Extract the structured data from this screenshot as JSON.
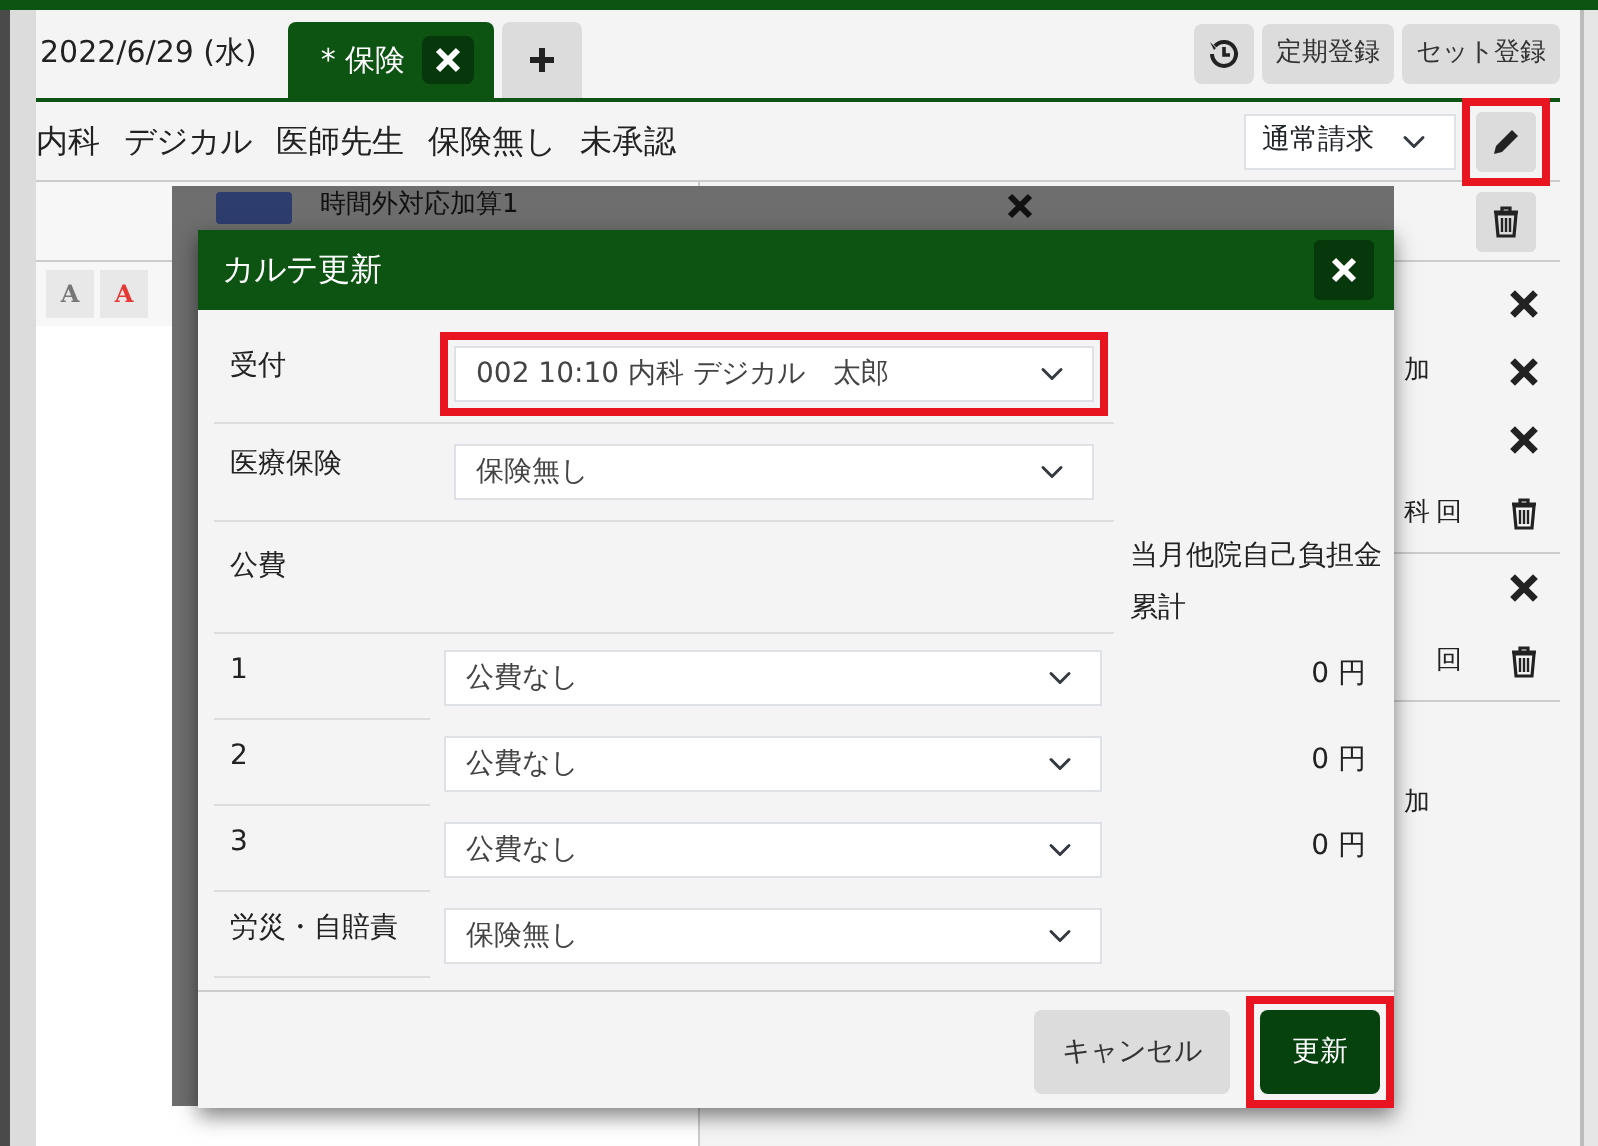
{
  "header": {
    "date": "2022/6/29 (水)",
    "tabs": [
      {
        "label": "* 保険",
        "selected": true
      }
    ],
    "buttons": [
      "定期登録",
      "セット登録"
    ]
  },
  "info": [
    "内科",
    "デジカル",
    "医師先生",
    "保険無し",
    "未承認"
  ],
  "billing_select": {
    "value": "通常請求"
  },
  "edit_button": {
    "highlighted": true
  },
  "font_buttons": [
    {
      "label": "A",
      "color": "#777777"
    },
    {
      "label": "A",
      "color": "#e53935"
    }
  ],
  "background_item": {
    "title": "時間外対応加算1"
  },
  "side_rows": [
    {
      "kind": "close",
      "text": ""
    },
    {
      "kind": "close",
      "text": "加"
    },
    {
      "kind": "close",
      "text": ""
    },
    {
      "kind": "delete",
      "text": "科",
      "count": "回"
    },
    {
      "kind": "close",
      "text": ""
    },
    {
      "kind": "delete",
      "text": "",
      "count": "回"
    },
    {
      "kind": "none",
      "text": "加"
    }
  ],
  "modal": {
    "title": "カルテ更新",
    "fields": [
      {
        "label": "受付",
        "value": "002 10:10 内科 デジカル　太郎",
        "highlighted": true
      },
      {
        "label": "医療保険",
        "value": "保険無し",
        "highlighted": false
      }
    ],
    "public_expense": {
      "label": "公費",
      "total_label": "当月他院自己負担金累計",
      "rows": [
        {
          "label": "1",
          "value": "公費なし",
          "amount": "0 円"
        },
        {
          "label": "2",
          "value": "公費なし",
          "amount": "0 円"
        },
        {
          "label": "3",
          "value": "公費なし",
          "amount": "0 円"
        }
      ]
    },
    "accident": {
      "label": "労災・自賠責",
      "value": "保険無し"
    },
    "buttons": [
      {
        "label": "キャンセル",
        "kind": "secondary",
        "highlighted": false
      },
      {
        "label": "更新",
        "kind": "primary",
        "highlighted": true
      }
    ]
  }
}
